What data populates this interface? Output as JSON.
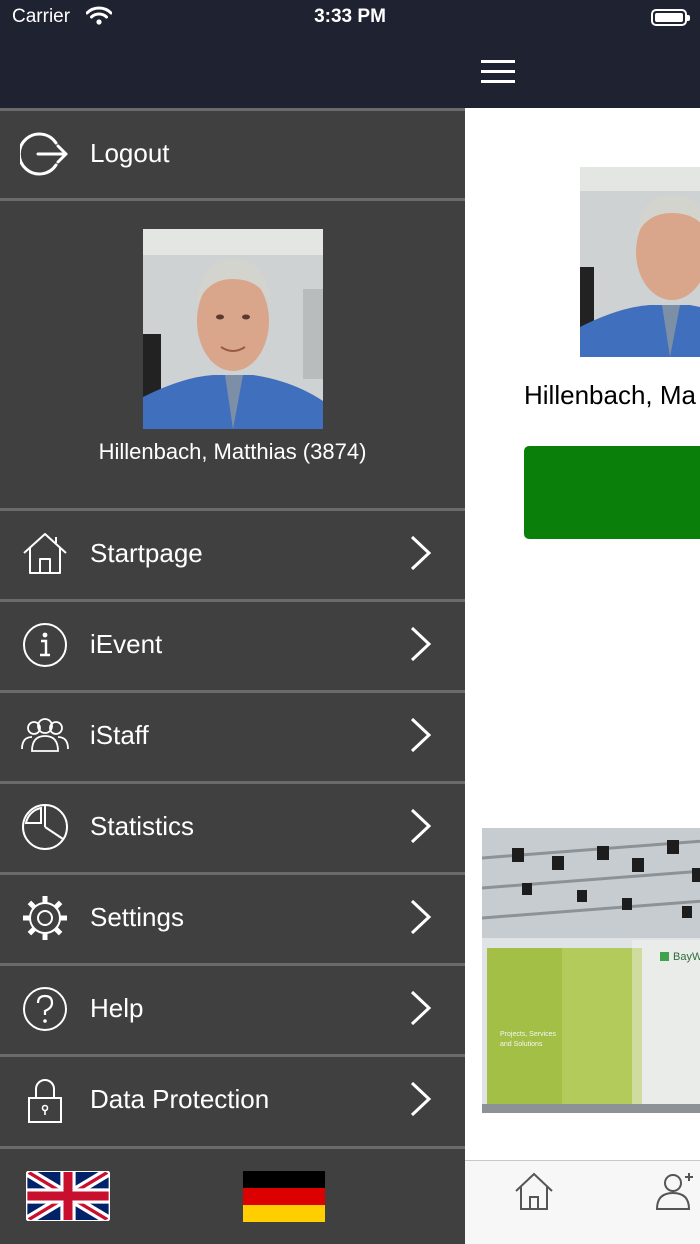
{
  "status_bar": {
    "carrier": "Carrier",
    "time": "3:33 PM"
  },
  "menu": {
    "logout_label": "Logout",
    "user_name": "Hillenbach, Matthias (3874)",
    "items": [
      {
        "label": "Startpage",
        "icon": "home-icon"
      },
      {
        "label": "iEvent",
        "icon": "info-icon"
      },
      {
        "label": "iStaff",
        "icon": "users-icon"
      },
      {
        "label": "Statistics",
        "icon": "pie-chart-icon"
      },
      {
        "label": "Settings",
        "icon": "gear-icon"
      },
      {
        "label": "Help",
        "icon": "help-icon"
      },
      {
        "label": "Data Protection",
        "icon": "lock-icon"
      }
    ],
    "languages": [
      "english-flag",
      "german-flag"
    ]
  },
  "main": {
    "user_name_partial": "Hillenbach, Ma",
    "action_button_color": "#0a7f0a",
    "event_image_text": {
      "brand": "BayWa",
      "caption_line1": "Projects, Services",
      "caption_line2": "and Solutions"
    },
    "tabs": [
      "home-tab",
      "profile-tab"
    ]
  },
  "colors": {
    "menu_bg": "#404040",
    "nav_bg": "#1f2230",
    "divider": "#6b6b6b",
    "accent_green": "#0a7f0a"
  }
}
